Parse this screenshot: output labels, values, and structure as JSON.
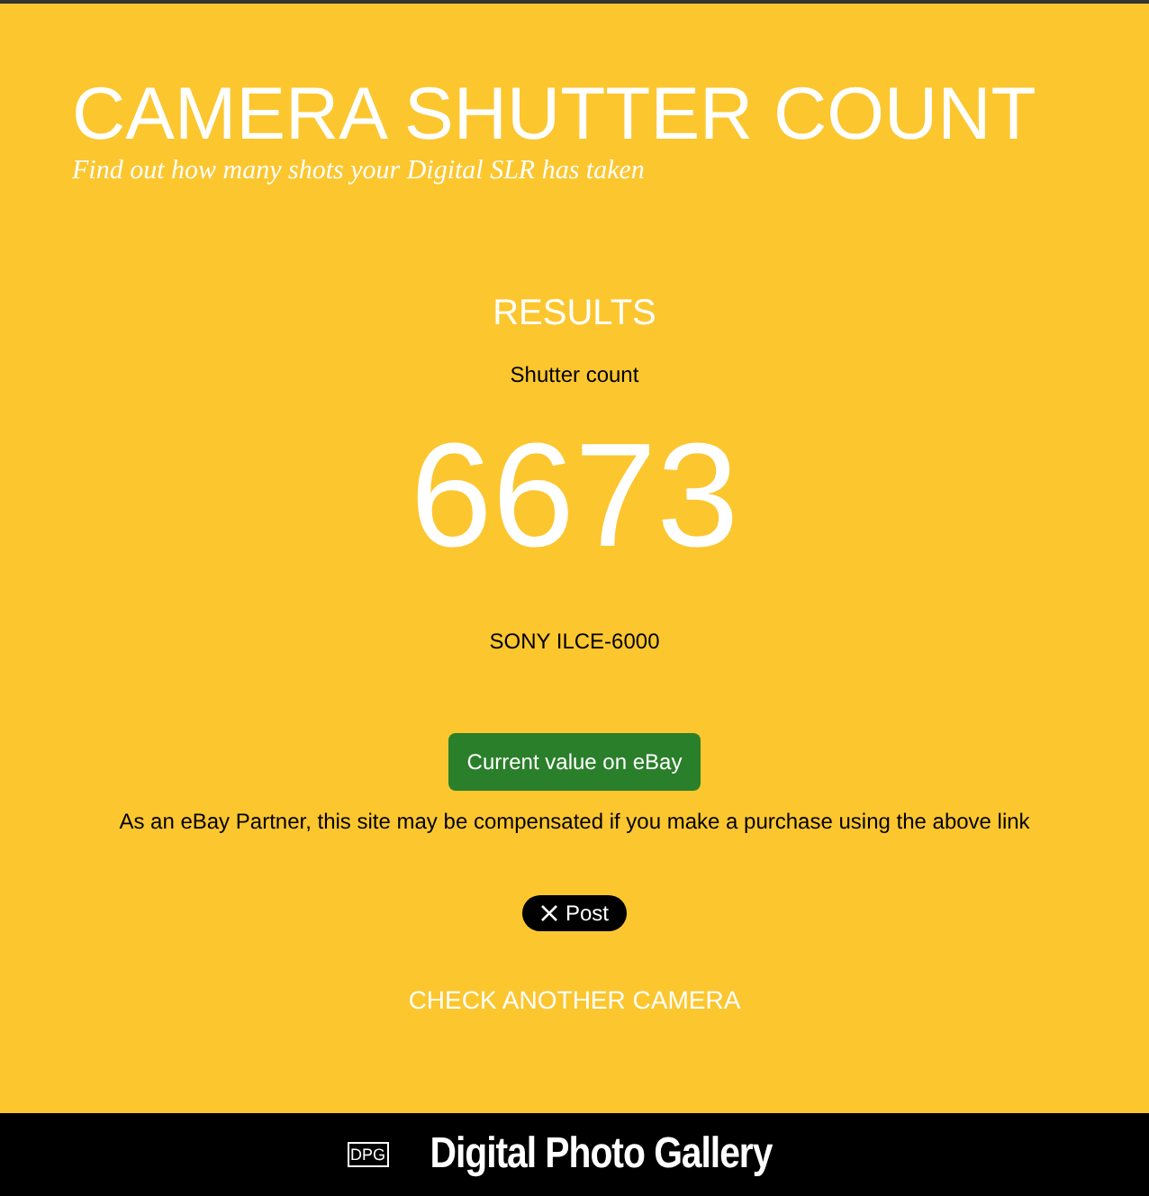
{
  "header": {
    "title": "CAMERA SHUTTER COUNT",
    "subtitle": "Find out how many shots your Digital SLR has taken"
  },
  "results": {
    "heading": "RESULTS",
    "label": "Shutter count",
    "count": "6673",
    "model": "SONY ILCE-6000"
  },
  "ebay_button": "Current value on eBay",
  "disclaimer": "As an eBay Partner, this site may be compensated if you make a purchase using the above link",
  "post_button": "Post",
  "check_link": "CHECK ANOTHER CAMERA",
  "footer": {
    "logo_mark": "DPG",
    "brand": "Digital Photo Gallery"
  }
}
